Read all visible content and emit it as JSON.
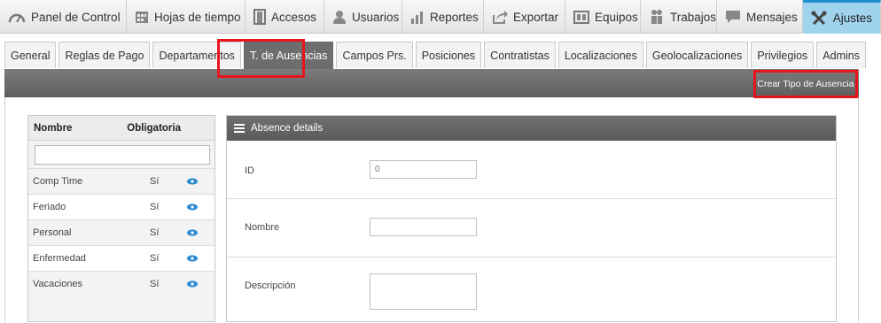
{
  "nav": {
    "items": [
      {
        "label": "Panel de Control",
        "icon": "dashboard-icon"
      },
      {
        "label": "Hojas de tiempo",
        "icon": "calendar-icon"
      },
      {
        "label": "Accesos",
        "icon": "door-icon"
      },
      {
        "label": "Usuarios",
        "icon": "user-icon"
      },
      {
        "label": "Reportes",
        "icon": "bar-chart-icon"
      },
      {
        "label": "Exportar",
        "icon": "export-icon"
      },
      {
        "label": "Equipos",
        "icon": "equipment-icon"
      },
      {
        "label": "Trabajos",
        "icon": "workers-icon"
      },
      {
        "label": "Mensajes",
        "icon": "chat-icon"
      },
      {
        "label": "Ajustes",
        "icon": "tools-icon",
        "active": true
      }
    ]
  },
  "subtabs": [
    {
      "label": "General"
    },
    {
      "label": "Reglas de Pago"
    },
    {
      "label": "Departamentos"
    },
    {
      "label": "T. de Ausencias",
      "active": true
    },
    {
      "label": "Campos Prs."
    },
    {
      "label": "Posiciones"
    },
    {
      "label": "Contratistas"
    },
    {
      "label": "Localizaciones"
    },
    {
      "label": "Geolocalizaciones"
    },
    {
      "label": "Privilegios"
    },
    {
      "label": "Admins"
    }
  ],
  "toolbar": {
    "create_label": "Crear Tipo de Ausencia"
  },
  "list": {
    "col_name": "Nombre",
    "col_required": "Obligatoria",
    "filter_value": "",
    "rows": [
      {
        "name": "Comp Time",
        "required": "Sí"
      },
      {
        "name": "Feriado",
        "required": "Sí"
      },
      {
        "name": "Personal",
        "required": "Sí"
      },
      {
        "name": "Enfermedad",
        "required": "Sí"
      },
      {
        "name": "Vacaciones",
        "required": "Sí"
      }
    ]
  },
  "details": {
    "title": "Absence details",
    "id_label": "ID",
    "id_placeholder": "0",
    "name_label": "Nombre",
    "name_value": "",
    "desc_label": "Descripción",
    "desc_value": ""
  },
  "colors": {
    "accent": "#1f8fd0",
    "active_nav_bg": "#9fd3ee",
    "highlight": "#e8141c",
    "dark_bar": "#6d6d6d"
  }
}
